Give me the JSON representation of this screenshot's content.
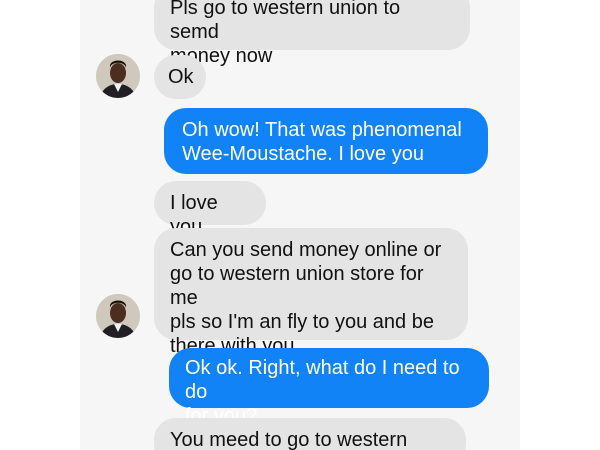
{
  "conversation": {
    "messages": [
      {
        "sender": "contact",
        "text": "Pls go to western union to semd\nmoney now"
      },
      {
        "sender": "contact",
        "text": "Ok"
      },
      {
        "sender": "me",
        "text": "Oh wow! That was phenomenal\nWee-Moustache. I love you"
      },
      {
        "sender": "contact",
        "text": "I love you"
      },
      {
        "sender": "contact",
        "text": "Can you send money online or\ngo to western union store for me\npls so I'm an fly to you and be\nthere with you"
      },
      {
        "sender": "me",
        "text": "Ok ok. Right, what do I need to do\nfor you?"
      },
      {
        "sender": "contact",
        "text": "You meed to go to western union"
      }
    ]
  },
  "colors": {
    "incoming_bubble": "#e4e4e5",
    "outgoing_bubble": "#1283f7",
    "screen_background": "#f6f6f6"
  },
  "icons": {
    "contact_avatar": "contact-avatar"
  }
}
